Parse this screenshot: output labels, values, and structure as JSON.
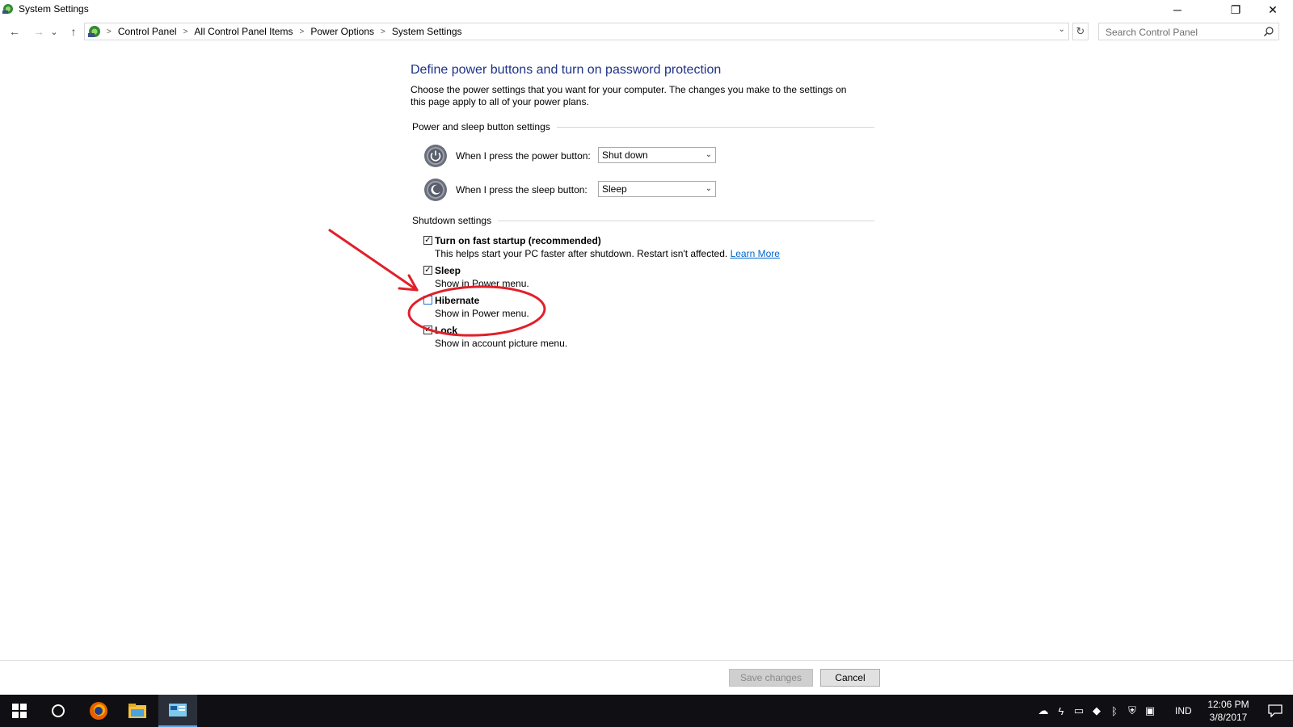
{
  "window": {
    "title": "System Settings",
    "minimize_glyph": "─",
    "restore_glyph": "❐",
    "close_glyph": "✕"
  },
  "nav": {
    "back_glyph": "←",
    "forward_glyph": "→",
    "recent_glyph": "⌄",
    "up_glyph": "↑"
  },
  "breadcrumb": {
    "items": [
      "Control Panel",
      "All Control Panel Items",
      "Power Options",
      "System Settings"
    ],
    "separator": ">",
    "dropdown_glyph": "⌄",
    "refresh_glyph": "↻"
  },
  "search": {
    "placeholder": "Search Control Panel"
  },
  "page": {
    "title": "Define power buttons and turn on password protection",
    "description": "Choose the power settings that you want for your computer. The changes you make to the settings on this page apply to all of your power plans."
  },
  "power_section": {
    "header": "Power and sleep button settings",
    "power_button_label": "When I press the power button:",
    "power_button_value": "Shut down",
    "sleep_button_label": "When I press the sleep button:",
    "sleep_button_value": "Sleep"
  },
  "shutdown_section": {
    "header": "Shutdown settings",
    "items": [
      {
        "label": "Turn on fast startup (recommended)",
        "desc": "This helps start your PC faster after shutdown. Restart isn't affected.",
        "link": "Learn More",
        "checked": true
      },
      {
        "label": "Sleep",
        "desc": "Show in Power menu.",
        "checked": true
      },
      {
        "label": "Hibernate",
        "desc": "Show in Power menu.",
        "checked": false
      },
      {
        "label": "Lock",
        "desc": "Show in account picture menu.",
        "checked": true
      }
    ]
  },
  "footer": {
    "save_label": "Save changes",
    "cancel_label": "Cancel"
  },
  "taskbar": {
    "language": "IND",
    "time": "12:06 PM",
    "date": "3/8/2017"
  },
  "colors": {
    "title_blue": "#1e3287",
    "link_blue": "#0066cc",
    "annotation_red": "#e0202a",
    "taskbar_bg": "#101014"
  }
}
